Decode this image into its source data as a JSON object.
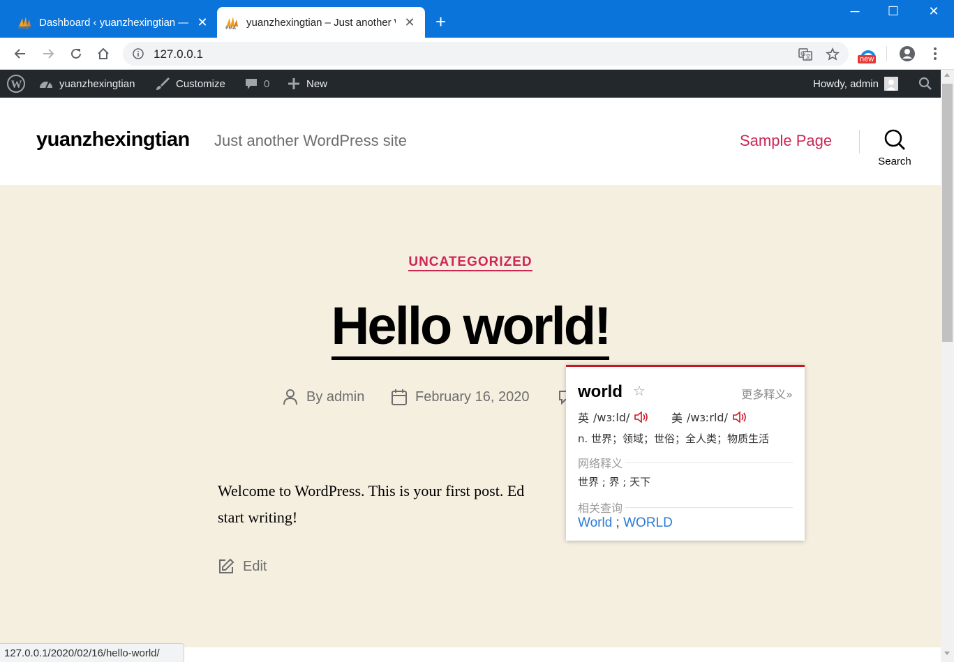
{
  "browser": {
    "tabs": [
      {
        "title": "Dashboard ‹ yuanzhexingtian — WordPress",
        "active": false,
        "close": "✕"
      },
      {
        "title": "yuanzhexingtian – Just another WordPress site",
        "active": true,
        "close": "✕"
      }
    ],
    "new_tab": "+",
    "window_controls": {
      "minimize": "─",
      "maximize": "☐",
      "close": "✕"
    },
    "url": "127.0.0.1",
    "extension_badge": "new",
    "status_url": "127.0.0.1/2020/02/16/hello-world/"
  },
  "adminbar": {
    "site_name": "yuanzhexingtian",
    "customize": "Customize",
    "comments_count": "0",
    "new": "New",
    "howdy": "Howdy, admin"
  },
  "header": {
    "site_title": "yuanzhexingtian",
    "tagline": "Just another WordPress site",
    "nav": [
      "Sample Page"
    ],
    "search_label": "Search"
  },
  "post": {
    "category": "UNCATEGORIZED",
    "title": "Hello world!",
    "author": "By admin",
    "date": "February 16, 2020",
    "body": "Welcome to WordPress. This is your first post. Edit or delete it, then start writing!",
    "body_visible_line1": "Welcome to WordPress. This is your first post. Ed",
    "body_visible_line2": "start writing!",
    "edit": "Edit"
  },
  "dictionary": {
    "word": "world",
    "star": "☆",
    "more": "更多释义»",
    "uk_label": "英",
    "uk_phonetic": "/wɜːld/",
    "us_label": "美",
    "us_phonetic": "/wɜːrld/",
    "definition": "n. 世界；领域；世俗；全人类；物质生活",
    "web_section": "网络释义",
    "web_defs": "世界 ; 界 ; 天下",
    "related_section": "相关查询",
    "related": [
      "World",
      "WORLD"
    ],
    "related_sep": " ; "
  },
  "colors": {
    "chrome_blue": "#0a74da",
    "wp_adminbar": "#23282d",
    "accent": "#cd2653",
    "main_bg": "#f5efe0",
    "dict_red": "#c81623",
    "dict_link": "#2a7ad2"
  }
}
